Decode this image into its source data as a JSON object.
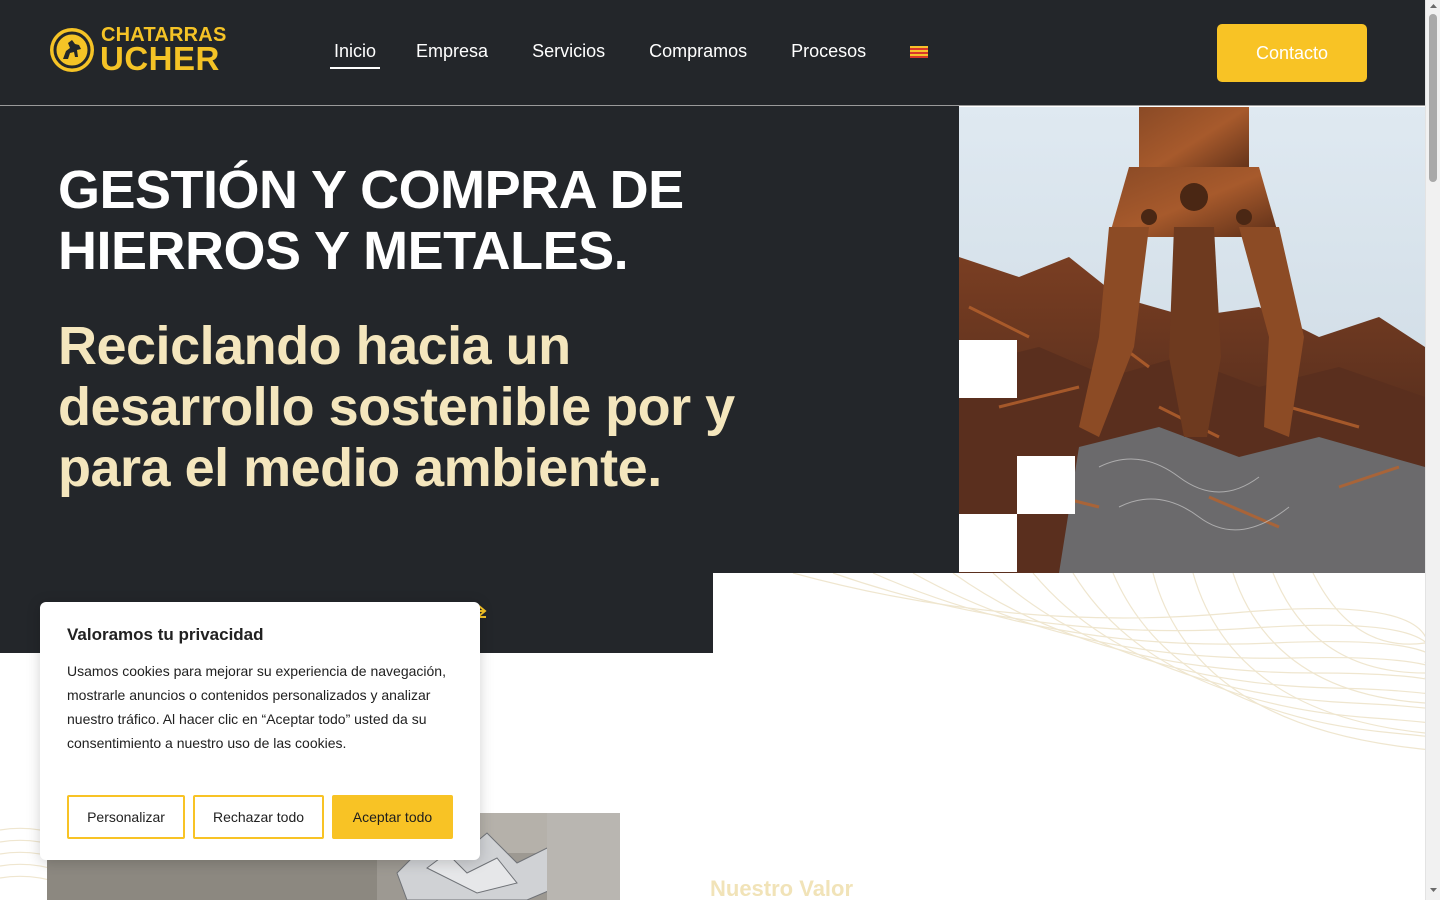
{
  "brand": {
    "line1": "CHATARRAS",
    "line2": "UCHER",
    "color": "#f5c326"
  },
  "nav": {
    "items": [
      {
        "label": "Inicio",
        "active": true
      },
      {
        "label": "Empresa",
        "active": false
      },
      {
        "label": "Servicios",
        "active": false
      },
      {
        "label": "Compramos",
        "active": false
      },
      {
        "label": "Procesos",
        "active": false
      }
    ],
    "language_icon": "catalan-flag-icon",
    "cta_label": "Contacto"
  },
  "hero": {
    "title": "GESTIÓN Y COMPRA DE HIERROS Y METALES.",
    "subtitle": "Reciclando hacia un desarrollo sostenible por y para el medio ambiente.",
    "background": "#23262a",
    "subtitle_color": "#f4e6bd"
  },
  "section": {
    "label": "Nuestro Valor"
  },
  "cookie_banner": {
    "title": "Valoramos tu privacidad",
    "text": "Usamos cookies para mejorar su experiencia de navegación, mostrarle anuncios o contenidos personalizados y analizar nuestro tráfico. Al hacer clic en “Aceptar todo” usted da su consentimiento a nuestro uso de las cookies.",
    "buttons": {
      "customize": "Personalizar",
      "reject": "Rechazar todo",
      "accept": "Aceptar todo"
    },
    "accent": "#f8c325"
  }
}
